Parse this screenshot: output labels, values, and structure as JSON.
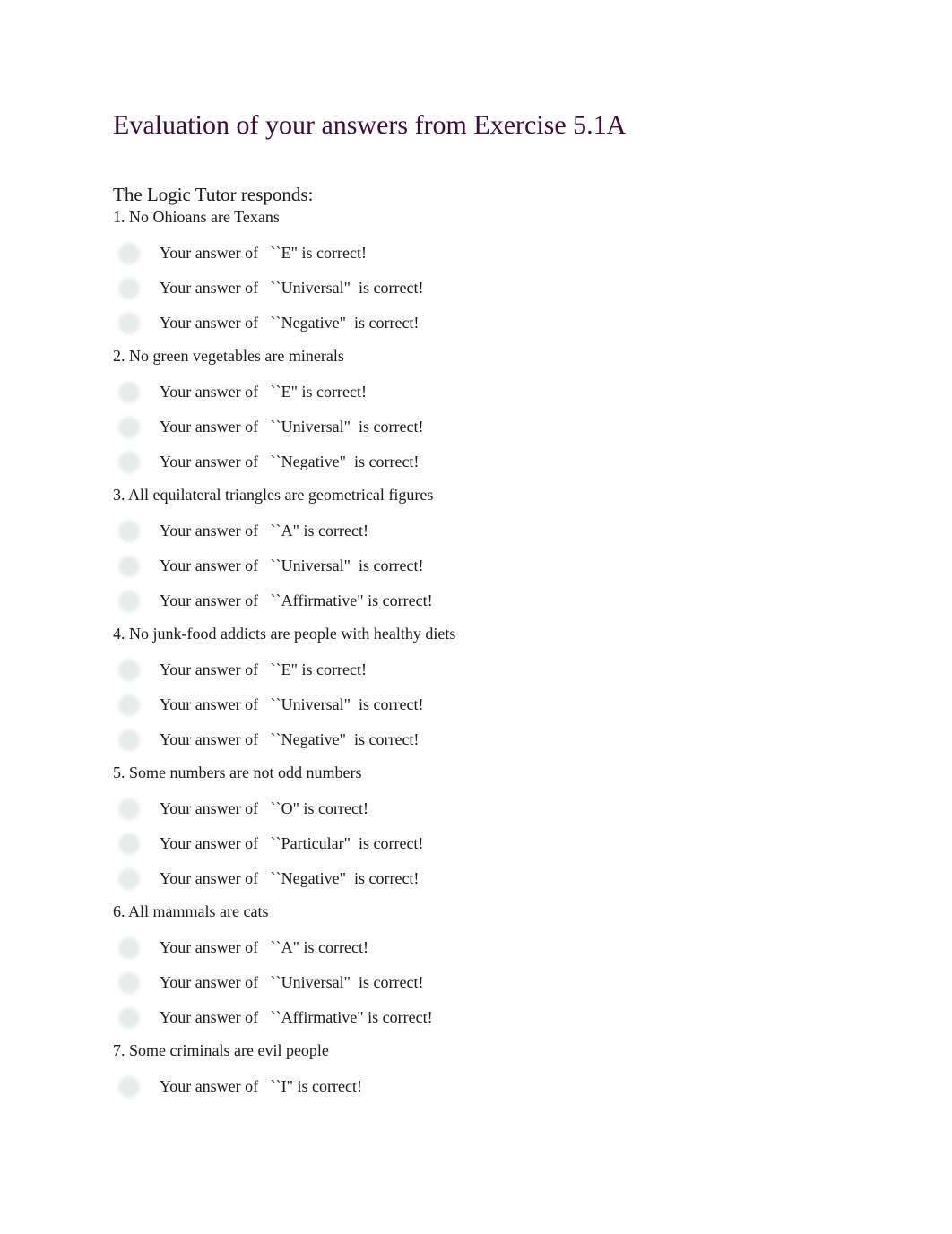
{
  "page": {
    "title": "Evaluation of your answers from Exercise 5.1A",
    "subtitle": "The Logic Tutor responds:"
  },
  "questions": [
    {
      "label": "1. No Ohioans are Texans",
      "answers": [
        "Your answer of   ``E\" is correct!",
        "Your answer of   ``Universal\"  is correct!",
        "Your answer of   ``Negative\"  is correct!"
      ]
    },
    {
      "label": "2. No green vegetables are minerals",
      "answers": [
        "Your answer of   ``E\" is correct!",
        "Your answer of   ``Universal\"  is correct!",
        "Your answer of   ``Negative\"  is correct!"
      ]
    },
    {
      "label": "3. All equilateral triangles are geometrical figures",
      "answers": [
        "Your answer of   ``A\" is correct!",
        "Your answer of   ``Universal\"  is correct!",
        "Your answer of   ``Affirmative\" is correct!"
      ]
    },
    {
      "label": "4. No junk-food addicts are people with healthy diets",
      "answers": [
        "Your answer of   ``E\" is correct!",
        "Your answer of   ``Universal\"  is correct!",
        "Your answer of   ``Negative\"  is correct!"
      ]
    },
    {
      "label": "5. Some numbers are not odd numbers",
      "answers": [
        "Your answer of   ``O\" is correct!",
        "Your answer of   ``Particular\"  is correct!",
        "Your answer of   ``Negative\"  is correct!"
      ]
    },
    {
      "label": "6. All mammals are cats",
      "answers": [
        "Your answer of   ``A\" is correct!",
        "Your answer of   ``Universal\"  is correct!",
        "Your answer of   ``Affirmative\" is correct!"
      ]
    },
    {
      "label": "7. Some criminals are evil people",
      "answers": [
        "Your answer of   ``I\" is correct!"
      ]
    }
  ],
  "icons": {
    "answer_status": "check-icon"
  },
  "colors": {
    "title": "#3d0c3a",
    "text": "#1a1a1a",
    "icon": "#e6ece8"
  }
}
